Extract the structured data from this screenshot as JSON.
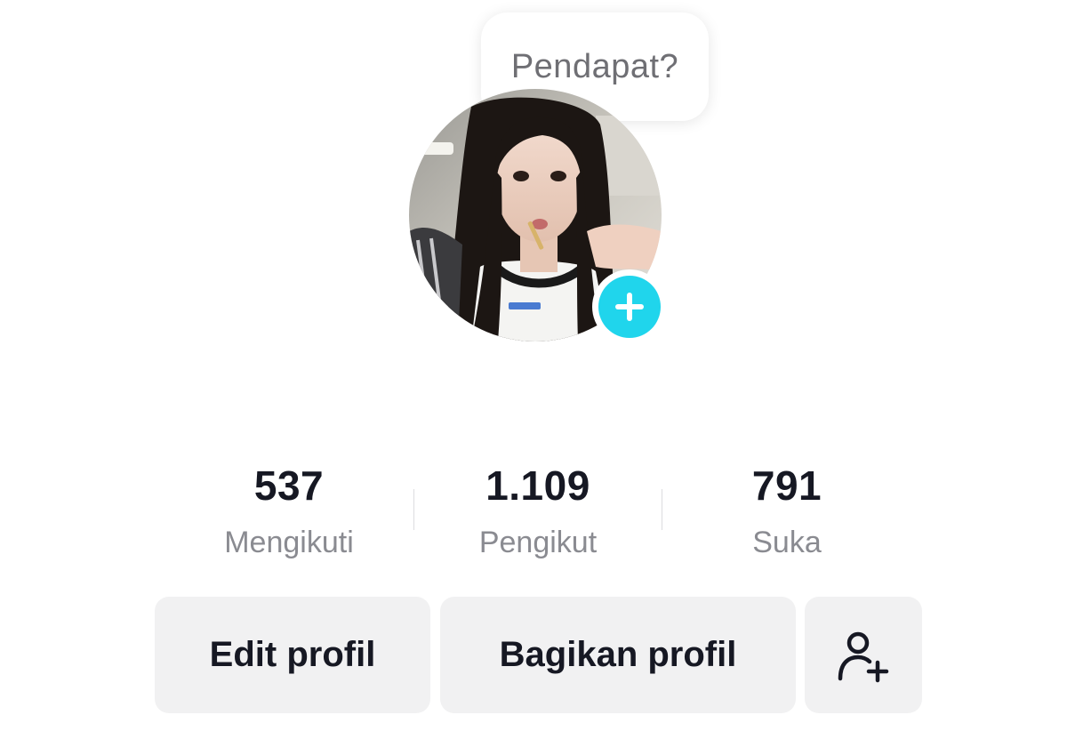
{
  "note": {
    "text": "Pendapat?"
  },
  "avatar": {
    "icon": "profile-photo",
    "add_icon": "plus-icon",
    "add_color": "#20d5ec"
  },
  "stats": [
    {
      "value": "537",
      "label": "Mengikuti"
    },
    {
      "value": "1.109",
      "label": "Pengikut"
    },
    {
      "value": "791",
      "label": "Suka"
    }
  ],
  "actions": {
    "edit_label": "Edit profil",
    "share_label": "Bagikan profil",
    "add_friend_icon": "add-friend-icon"
  }
}
